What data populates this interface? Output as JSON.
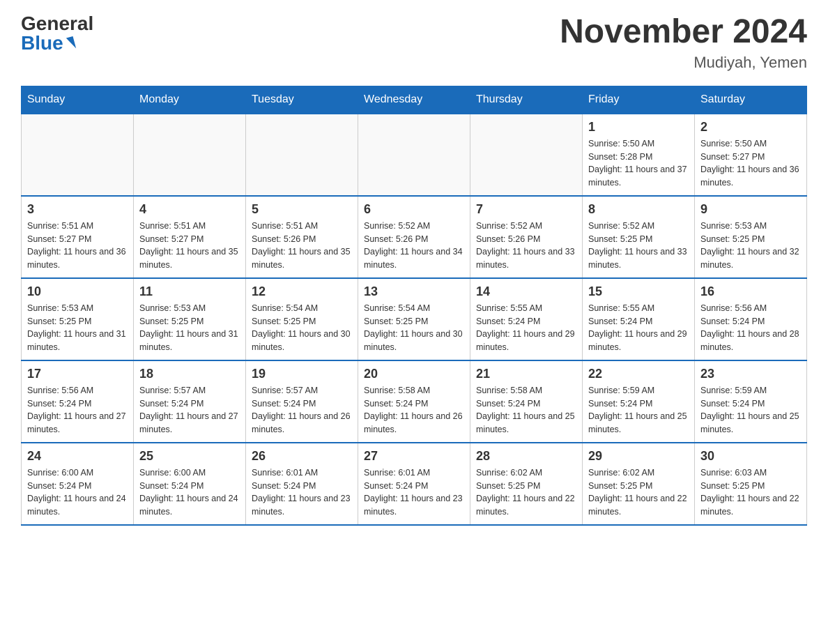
{
  "header": {
    "logo_general": "General",
    "logo_blue": "Blue",
    "month_title": "November 2024",
    "location": "Mudiyah, Yemen"
  },
  "weekdays": [
    "Sunday",
    "Monday",
    "Tuesday",
    "Wednesday",
    "Thursday",
    "Friday",
    "Saturday"
  ],
  "weeks": [
    [
      {
        "day": "",
        "info": ""
      },
      {
        "day": "",
        "info": ""
      },
      {
        "day": "",
        "info": ""
      },
      {
        "day": "",
        "info": ""
      },
      {
        "day": "",
        "info": ""
      },
      {
        "day": "1",
        "info": "Sunrise: 5:50 AM\nSunset: 5:28 PM\nDaylight: 11 hours and 37 minutes."
      },
      {
        "day": "2",
        "info": "Sunrise: 5:50 AM\nSunset: 5:27 PM\nDaylight: 11 hours and 36 minutes."
      }
    ],
    [
      {
        "day": "3",
        "info": "Sunrise: 5:51 AM\nSunset: 5:27 PM\nDaylight: 11 hours and 36 minutes."
      },
      {
        "day": "4",
        "info": "Sunrise: 5:51 AM\nSunset: 5:27 PM\nDaylight: 11 hours and 35 minutes."
      },
      {
        "day": "5",
        "info": "Sunrise: 5:51 AM\nSunset: 5:26 PM\nDaylight: 11 hours and 35 minutes."
      },
      {
        "day": "6",
        "info": "Sunrise: 5:52 AM\nSunset: 5:26 PM\nDaylight: 11 hours and 34 minutes."
      },
      {
        "day": "7",
        "info": "Sunrise: 5:52 AM\nSunset: 5:26 PM\nDaylight: 11 hours and 33 minutes."
      },
      {
        "day": "8",
        "info": "Sunrise: 5:52 AM\nSunset: 5:25 PM\nDaylight: 11 hours and 33 minutes."
      },
      {
        "day": "9",
        "info": "Sunrise: 5:53 AM\nSunset: 5:25 PM\nDaylight: 11 hours and 32 minutes."
      }
    ],
    [
      {
        "day": "10",
        "info": "Sunrise: 5:53 AM\nSunset: 5:25 PM\nDaylight: 11 hours and 31 minutes."
      },
      {
        "day": "11",
        "info": "Sunrise: 5:53 AM\nSunset: 5:25 PM\nDaylight: 11 hours and 31 minutes."
      },
      {
        "day": "12",
        "info": "Sunrise: 5:54 AM\nSunset: 5:25 PM\nDaylight: 11 hours and 30 minutes."
      },
      {
        "day": "13",
        "info": "Sunrise: 5:54 AM\nSunset: 5:25 PM\nDaylight: 11 hours and 30 minutes."
      },
      {
        "day": "14",
        "info": "Sunrise: 5:55 AM\nSunset: 5:24 PM\nDaylight: 11 hours and 29 minutes."
      },
      {
        "day": "15",
        "info": "Sunrise: 5:55 AM\nSunset: 5:24 PM\nDaylight: 11 hours and 29 minutes."
      },
      {
        "day": "16",
        "info": "Sunrise: 5:56 AM\nSunset: 5:24 PM\nDaylight: 11 hours and 28 minutes."
      }
    ],
    [
      {
        "day": "17",
        "info": "Sunrise: 5:56 AM\nSunset: 5:24 PM\nDaylight: 11 hours and 27 minutes."
      },
      {
        "day": "18",
        "info": "Sunrise: 5:57 AM\nSunset: 5:24 PM\nDaylight: 11 hours and 27 minutes."
      },
      {
        "day": "19",
        "info": "Sunrise: 5:57 AM\nSunset: 5:24 PM\nDaylight: 11 hours and 26 minutes."
      },
      {
        "day": "20",
        "info": "Sunrise: 5:58 AM\nSunset: 5:24 PM\nDaylight: 11 hours and 26 minutes."
      },
      {
        "day": "21",
        "info": "Sunrise: 5:58 AM\nSunset: 5:24 PM\nDaylight: 11 hours and 25 minutes."
      },
      {
        "day": "22",
        "info": "Sunrise: 5:59 AM\nSunset: 5:24 PM\nDaylight: 11 hours and 25 minutes."
      },
      {
        "day": "23",
        "info": "Sunrise: 5:59 AM\nSunset: 5:24 PM\nDaylight: 11 hours and 25 minutes."
      }
    ],
    [
      {
        "day": "24",
        "info": "Sunrise: 6:00 AM\nSunset: 5:24 PM\nDaylight: 11 hours and 24 minutes."
      },
      {
        "day": "25",
        "info": "Sunrise: 6:00 AM\nSunset: 5:24 PM\nDaylight: 11 hours and 24 minutes."
      },
      {
        "day": "26",
        "info": "Sunrise: 6:01 AM\nSunset: 5:24 PM\nDaylight: 11 hours and 23 minutes."
      },
      {
        "day": "27",
        "info": "Sunrise: 6:01 AM\nSunset: 5:24 PM\nDaylight: 11 hours and 23 minutes."
      },
      {
        "day": "28",
        "info": "Sunrise: 6:02 AM\nSunset: 5:25 PM\nDaylight: 11 hours and 22 minutes."
      },
      {
        "day": "29",
        "info": "Sunrise: 6:02 AM\nSunset: 5:25 PM\nDaylight: 11 hours and 22 minutes."
      },
      {
        "day": "30",
        "info": "Sunrise: 6:03 AM\nSunset: 5:25 PM\nDaylight: 11 hours and 22 minutes."
      }
    ]
  ]
}
